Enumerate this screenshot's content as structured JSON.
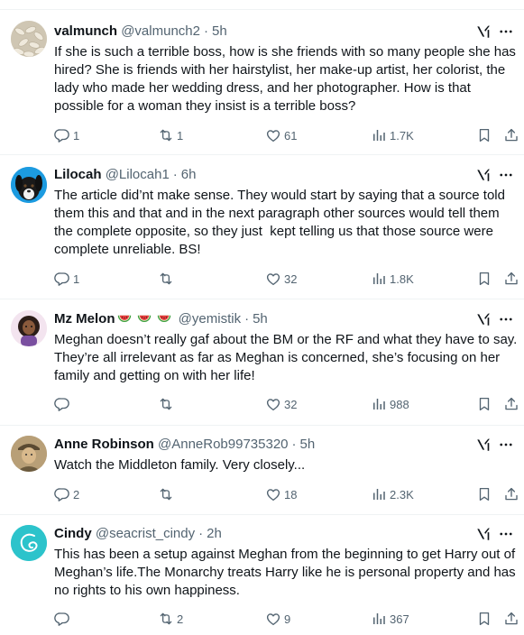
{
  "tweets": [
    {
      "name": "valmunch",
      "handle": "@valmunch2",
      "time": "5h",
      "text": "If she is such a terrible boss, how is she friends with so many people she has hired? She is friends with her hairstylist, her make-up artist, her colorist, the lady who made her wedding dress, and her photographer. How is that possible for a woman they insist is a terrible boss?",
      "replies": "1",
      "reposts": "1",
      "likes": "61",
      "views": "1.7K"
    },
    {
      "name": "Lilocah",
      "handle": "@Lilocah1",
      "time": "6h",
      "text": "The article did’nt make sense. They would start by saying that a source told them this and that and in the next paragraph other sources would tell them the complete opposite, so they just  kept telling us that those source were complete unreliable. BS!",
      "replies": "1",
      "reposts": "",
      "likes": "32",
      "views": "1.8K"
    },
    {
      "name": "Mz Melon",
      "handle": "@yemistik",
      "time": "5h",
      "text": "Meghan doesn’t really gaf about the BM or the RF and what they have to say. They’re all irrelevant as far as Meghan is concerned, she’s focusing on her family and getting on with her life!",
      "replies": "",
      "reposts": "",
      "likes": "32",
      "views": "988"
    },
    {
      "name": "Anne Robinson",
      "handle": "@AnneRob99735320",
      "time": "5h",
      "text": "Watch the Middleton family. Very closely...",
      "replies": "2",
      "reposts": "",
      "likes": "18",
      "views": "2.3K"
    },
    {
      "name": "Cindy",
      "handle": "@seacrist_cindy",
      "time": "2h",
      "text": "This has been a setup against Meghan from the beginning to get Harry out of Meghan’s life.The Monarchy treats Harry like he is personal property and has no rights to his own happiness.",
      "replies": "",
      "reposts": "2",
      "likes": "9",
      "views": "367"
    }
  ],
  "separator": "·",
  "colors": {
    "text": "#0f1419",
    "secondary": "#536471",
    "divider": "#eff3f4"
  },
  "icons": [
    "grok-icon",
    "more-icon",
    "reply-icon",
    "repost-icon",
    "like-icon",
    "views-icon",
    "bookmark-icon",
    "share-icon",
    "watermelon-icon"
  ]
}
